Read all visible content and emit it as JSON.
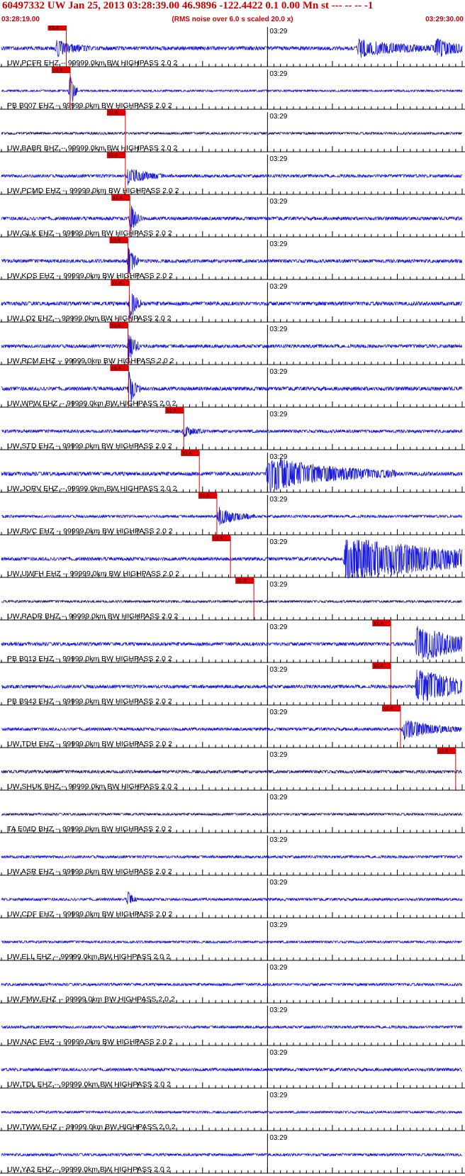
{
  "header": {
    "title": "60497332 UW Jan 25, 2013 03:28:39.00   46.9896 -122.4422  0.1 0.00 Mn st --- -- --  -1",
    "subtitle": "(RMS noise over 6.0 s scaled 20.0 x)",
    "start_time": "03:28:19.00",
    "end_time": "03:29:30.00"
  },
  "colors": {
    "trace": "#1a1adc",
    "trace_broadband": "#2a1a7a",
    "pick": "#e00000",
    "text_red": "#d00000",
    "axis": "#000000"
  },
  "chart_data": {
    "type": "line",
    "title": "60497332 UW Jan 25, 2013 03:28:39.00   46.9896 -122.4422  0.1 0.00 Mn st --- -- --  -1",
    "x_range_seconds": [
      0,
      71
    ],
    "x_start": "03:28:19.00",
    "x_end": "03:29:30.00",
    "minute_label": "03:29",
    "minute_at_seconds": 41,
    "pick_label": "x1.4",
    "series": [
      {
        "label": "UW PCFR EHZ -- 99999.0km BW  HIGHPASS  2.0  2",
        "pick_s": 10.0,
        "amp": 0.55,
        "events": [
          [
            8.5,
            2.5,
            2.3
          ],
          [
            55,
            6,
            2.6
          ],
          [
            67,
            4,
            2.3
          ]
        ],
        "type": "sp"
      },
      {
        "label": "PB B007 EHZ -- 99999.0km BW  HIGHPASS  2.0  2",
        "pick_s": 10.6,
        "amp": 0.3,
        "events": [
          [
            10.6,
            0.5,
            7
          ]
        ],
        "type": "sp"
      },
      {
        "label": "UW BABR BHZ -- 99999.0km BW  HIGHPASS  2.0  2",
        "pick_s": 19.1,
        "amp": 0.35,
        "events": [],
        "type": "bb"
      },
      {
        "label": "UW PCMD EHZ -- 99999.0km BW  HIGHPASS  2.0  2",
        "pick_s": 19.1,
        "amp": 0.45,
        "events": [
          [
            19.5,
            2.5,
            2.5
          ]
        ],
        "type": "sp"
      },
      {
        "label": "UW GLK EHZ -- 99999.0km BW  HIGHPASS  2.0  2",
        "pick_s": 19.8,
        "amp": 0.5,
        "events": [
          [
            19.9,
            0.8,
            5.5
          ]
        ],
        "type": "sp"
      },
      {
        "label": "UW KOS EHZ -- 99999.0km BW  HIGHPASS  2.0  2",
        "pick_s": 19.5,
        "amp": 0.5,
        "events": [
          [
            19.6,
            0.7,
            5.5
          ]
        ],
        "type": "sp"
      },
      {
        "label": "UW LO2 EHZ -- 99999.0km BW  HIGHPASS  2.0  2",
        "pick_s": 19.7,
        "amp": 0.55,
        "events": [
          [
            19.8,
            0.8,
            5.5
          ]
        ],
        "type": "sp"
      },
      {
        "label": "UW RCM EHZ -- 99999.0km BW  HIGHPASS  2.0  2",
        "pick_s": 19.5,
        "amp": 0.5,
        "events": [
          [
            19.6,
            0.8,
            5.5
          ]
        ],
        "type": "sp"
      },
      {
        "label": "UW WPW EHZ -- 99999.0km BW  HIGHPASS  2.0  2",
        "pick_s": 19.6,
        "amp": 0.55,
        "events": [
          [
            19.7,
            0.8,
            5
          ]
        ],
        "type": "sp"
      },
      {
        "label": "UW STD EHZ -- 99999.0km BW  HIGHPASS  2.0  2",
        "pick_s": 28.1,
        "amp": 0.45,
        "events": [
          [
            28.1,
            1.5,
            1.6
          ]
        ],
        "type": "sp"
      },
      {
        "label": "UW JORV EHZ -- 99999.0km BW  HIGHPASS  2.0  2",
        "pick_s": 30.5,
        "amp": 0.55,
        "events": [
          [
            41,
            9,
            5.5
          ]
        ],
        "type": "sp"
      },
      {
        "label": "UW RVC EHZ -- 99999.0km BW  HIGHPASS  2.0  2",
        "pick_s": 33.2,
        "amp": 0.4,
        "events": [
          [
            33.5,
            2.5,
            2.8
          ]
        ],
        "type": "sp"
      },
      {
        "label": "UW UWFH EHZ -- 99999.0km BW  HIGHPASS  2.0  2",
        "pick_s": 35.3,
        "amp": 0.5,
        "events": [
          [
            53,
            17.5,
            7
          ]
        ],
        "type": "sp"
      },
      {
        "label": "UW RADR BHZ -- 99999.0km BW  HIGHPASS  2.0  2",
        "pick_s": 38.9,
        "amp": 0.35,
        "events": [],
        "type": "bb"
      },
      {
        "label": "PB B013 EHZ -- 99999.0km BW  HIGHPASS  2.0  2",
        "pick_s": 60.0,
        "amp": 0.5,
        "events": [
          [
            64,
            7,
            5.5
          ]
        ],
        "type": "sp"
      },
      {
        "label": "PB B943 EHZ -- 99999.0km BW  HIGHPASS  2.0  2",
        "pick_s": 60.0,
        "amp": 0.5,
        "events": [
          [
            64,
            7,
            5.5
          ]
        ],
        "type": "sp"
      },
      {
        "label": "UW TDH EHZ -- 99999.0km BW  HIGHPASS  2.0  2",
        "pick_s": 61.5,
        "amp": 0.45,
        "events": [
          [
            62,
            4,
            3
          ]
        ],
        "type": "sp"
      },
      {
        "label": "UW SHUK BHZ -- 99999.0km BW  HIGHPASS  2.0  2",
        "pick_s": 70.0,
        "amp": 0.45,
        "events": [],
        "type": "bb"
      },
      {
        "label": "TA E04D BHZ -- 99999.0km BW  HIGHPASS  2.0  2",
        "pick_s": null,
        "amp": 0.35,
        "events": [],
        "type": "bb"
      },
      {
        "label": "UW ASR EHZ -- 99999.0km BW  HIGHPASS  2.0  2",
        "pick_s": null,
        "amp": 0.4,
        "events": [],
        "type": "sp"
      },
      {
        "label": "UW CDF EHZ -- 99999.0km BW  HIGHPASS  2.0  2",
        "pick_s": null,
        "amp": 0.4,
        "events": [
          [
            19.5,
            0.6,
            2.5
          ]
        ],
        "type": "sp"
      },
      {
        "label": "UW ELL EHZ -- 99999.0km BW  HIGHPASS  2.0  2",
        "pick_s": null,
        "amp": 0.35,
        "events": [],
        "type": "sp"
      },
      {
        "label": "UW FMW EHZ -- 99999.0km BW  HIGHPASS  2.0  2",
        "pick_s": null,
        "amp": 0.4,
        "events": [],
        "type": "sp"
      },
      {
        "label": "UW NAC EHZ -- 99999.0km BW  HIGHPASS  2.0  2",
        "pick_s": null,
        "amp": 0.4,
        "events": [],
        "type": "sp"
      },
      {
        "label": "UW TDL EHZ -- 99999.0km BW  HIGHPASS  2.0  2",
        "pick_s": null,
        "amp": 0.45,
        "events": [],
        "type": "sp"
      },
      {
        "label": "UW TWW EHZ -- 99999.0km BW  HIGHPASS  2.0  2",
        "pick_s": null,
        "amp": 0.35,
        "events": [],
        "type": "sp"
      },
      {
        "label": "UW YA2 EHZ -- 99999.0km BW  HIGHPASS  2.0  2",
        "pick_s": null,
        "amp": 0.4,
        "events": [],
        "type": "sp"
      }
    ]
  }
}
